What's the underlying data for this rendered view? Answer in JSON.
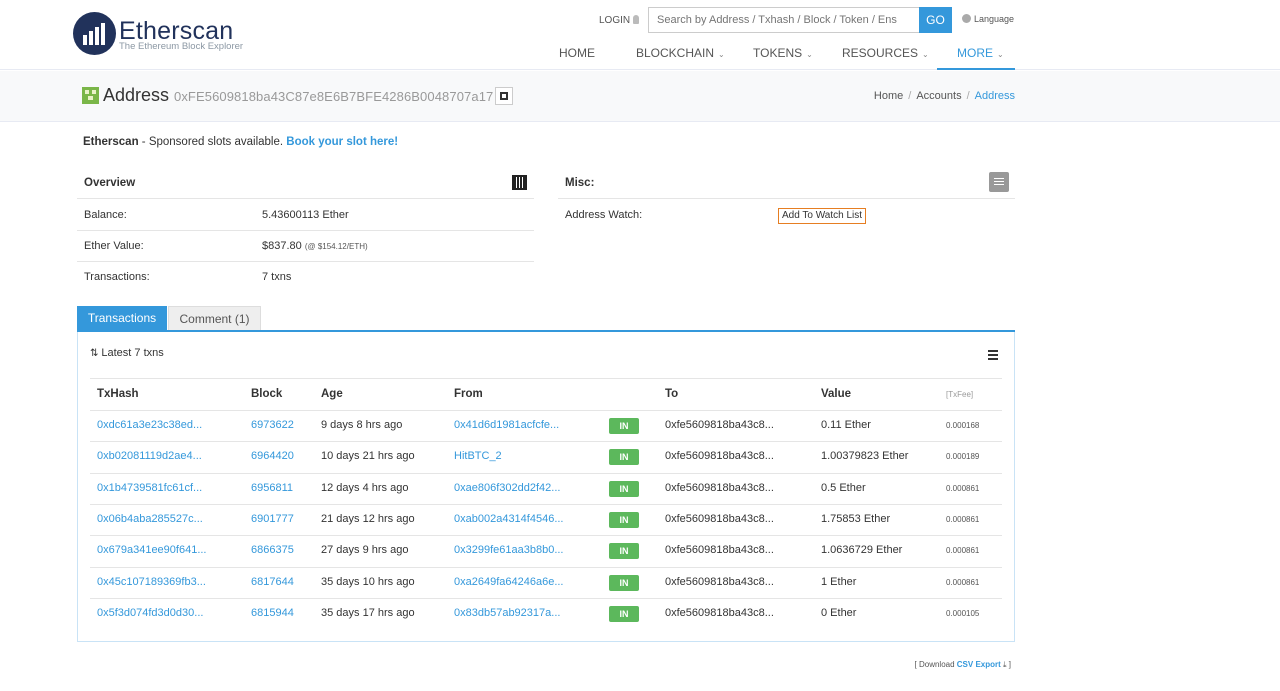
{
  "brand": {
    "name": "Etherscan",
    "tagline": "The Ethereum Block Explorer"
  },
  "header": {
    "login": "LOGIN",
    "search_placeholder": "Search by Address / Txhash / Block / Token / Ens",
    "go": "GO",
    "language": "Language",
    "nav": [
      "HOME",
      "BLOCKCHAIN",
      "TOKENS",
      "RESOURCES",
      "MORE"
    ]
  },
  "address": {
    "title": "Address",
    "hash": "0xFE5609818ba43C87e8E6B7BFE4286B0048707a17"
  },
  "breadcrumb": [
    "Home",
    "Accounts",
    "Address"
  ],
  "sponsor": {
    "brand": "Etherscan",
    "text": " - Sponsored slots available. ",
    "link": "Book your slot here!"
  },
  "overview": {
    "title": "Overview",
    "balance_label": "Balance:",
    "balance": "5.43600113 Ether",
    "ether_value_label": "Ether Value:",
    "ether_value": "$837.80",
    "ether_rate": "(@ $154.12/ETH)",
    "transactions_label": "Transactions:",
    "transactions": "7 txns"
  },
  "misc": {
    "title": "Misc:",
    "watch_label": "Address Watch:",
    "watch_button": "Add To Watch List"
  },
  "tabs": [
    "Transactions",
    "Comment (1)"
  ],
  "txlist": {
    "heading": "Latest 7 txns",
    "columns": [
      "TxHash",
      "Block",
      "Age",
      "From",
      "To",
      "Value",
      "[TxFee]"
    ],
    "direction": "IN",
    "rows": [
      {
        "hash": "0xdc61a3e23c38ed...",
        "block": "6973622",
        "age": "9 days 8 hrs ago",
        "from": "0x41d6d1981acfcfe...",
        "to": "0xfe5609818ba43c8...",
        "value": "0.11 Ether",
        "fee": "0.000168"
      },
      {
        "hash": "0xb02081119d2ae4...",
        "block": "6964420",
        "age": "10 days 21 hrs ago",
        "from": "HitBTC_2",
        "to": "0xfe5609818ba43c8...",
        "value": "1.00379823 Ether",
        "fee": "0.000189"
      },
      {
        "hash": "0x1b4739581fc61cf...",
        "block": "6956811",
        "age": "12 days 4 hrs ago",
        "from": "0xae806f302dd2f42...",
        "to": "0xfe5609818ba43c8...",
        "value": "0.5 Ether",
        "fee": "0.000861"
      },
      {
        "hash": "0x06b4aba285527c...",
        "block": "6901777",
        "age": "21 days 12 hrs ago",
        "from": "0xab002a4314f4546...",
        "to": "0xfe5609818ba43c8...",
        "value": "1.75853 Ether",
        "fee": "0.000861"
      },
      {
        "hash": "0x679a341ee90f641...",
        "block": "6866375",
        "age": "27 days 9 hrs ago",
        "from": "0x3299fe61aa3b8b0...",
        "to": "0xfe5609818ba43c8...",
        "value": "1.0636729 Ether",
        "fee": "0.000861"
      },
      {
        "hash": "0x45c107189369fb3...",
        "block": "6817644",
        "age": "35 days 10 hrs ago",
        "from": "0xa2649fa64246a6e...",
        "to": "0xfe5609818ba43c8...",
        "value": "1 Ether",
        "fee": "0.000861"
      },
      {
        "hash": "0x5f3d074fd3d0d30...",
        "block": "6815944",
        "age": "35 days 17 hrs ago",
        "from": "0x83db57ab92317a...",
        "to": "0xfe5609818ba43c8...",
        "value": "0 Ether",
        "fee": "0.000105"
      }
    ]
  },
  "footer": {
    "prefix": "[ Download ",
    "link": "CSV Export",
    "suffix": " ]"
  }
}
